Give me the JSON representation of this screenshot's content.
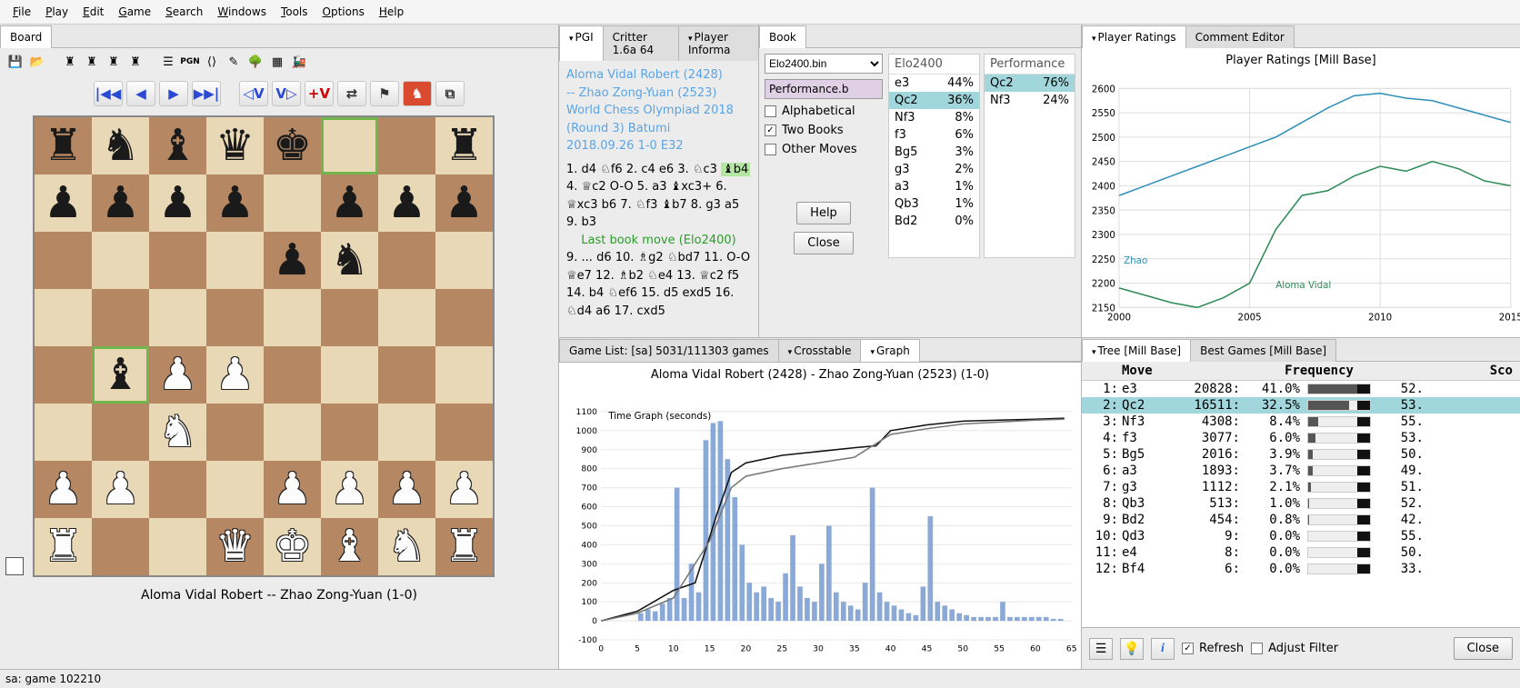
{
  "menu": [
    "File",
    "Play",
    "Edit",
    "Game",
    "Search",
    "Windows",
    "Tools",
    "Options",
    "Help"
  ],
  "board_tab": "Board",
  "board_caption": "Aloma Vidal Robert  --  Zhao Zong-Yuan  (1-0)",
  "status_bar": "sa: game  102210",
  "board": {
    "highlights": [
      "f8",
      "b4"
    ],
    "pieces": {
      "a8": "br",
      "b8": "bn",
      "c8": "bb",
      "d8": "bq",
      "e8": "bk",
      "h8": "br",
      "a7": "bp",
      "b7": "bp",
      "c7": "bp",
      "d7": "bp",
      "f7": "bp",
      "g7": "bp",
      "h7": "bp",
      "e6": "bp",
      "f6": "bn",
      "b4": "bb",
      "c4": "wp",
      "d4": "wp",
      "c3": "wn",
      "a2": "wp",
      "b2": "wp",
      "e2": "wp",
      "f2": "wp",
      "g2": "wp",
      "h2": "wp",
      "a1": "wr",
      "d1": "wq",
      "e1": "wk",
      "f1": "wb",
      "g1": "wn",
      "h1": "wr"
    }
  },
  "pgi": {
    "tabs": [
      "PGI",
      "Critter 1.6a 64",
      "Player Informa"
    ],
    "header": [
      "Aloma Vidal Robert  (2428)",
      "--  Zhao Zong-Yuan  (2523)",
      "World Chess Olympiad 2018 (Round 3)  Batumi",
      "2018.09.26  1-0  E32"
    ],
    "moves_pre": "1. d4 ♘f6 2. c4 e6 3. ♘c3 ",
    "hl_move": "♝b4",
    "moves_post": " 4. ♕c2 O-O 5. a3 ♝xc3+ 6. ♕xc3 b6 7. ♘f3 ♝b7 8. g3 a5 9. b3",
    "book_note": "Last book move (Elo2400)",
    "moves2": "9. ... d6 10. ♗g2 ♘bd7 11. O-O ♕e7 12. ♗b2 ♘e4 13. ♕c2 f5 14. b4 ♘ef6 15. d5 exd5 16. ♘d4 a6 17. cxd5"
  },
  "book": {
    "tab": "Book",
    "file": "Elo2400.bin",
    "perf": "Performance.b",
    "options": {
      "alphabetical": "Alphabetical",
      "two_books": "Two Books",
      "other_moves": "Other Moves"
    },
    "help": "Help",
    "close": "Close",
    "col1": {
      "title": "Elo2400",
      "rows": [
        {
          "m": "e3",
          "p": "44%"
        },
        {
          "m": "Qc2",
          "p": "36%",
          "hl": true
        },
        {
          "m": "Nf3",
          "p": "8%"
        },
        {
          "m": "f3",
          "p": "6%"
        },
        {
          "m": "Bg5",
          "p": "3%"
        },
        {
          "m": "g3",
          "p": "2%"
        },
        {
          "m": "a3",
          "p": "1%"
        },
        {
          "m": "Qb3",
          "p": "1%"
        },
        {
          "m": "Bd2",
          "p": "0%"
        }
      ]
    },
    "col2": {
      "title": "Performance",
      "rows": [
        {
          "m": "Qc2",
          "p": "76%",
          "hl": true
        },
        {
          "m": "Nf3",
          "p": "24%"
        }
      ]
    }
  },
  "player_ratings": {
    "tabs": [
      "Player Ratings",
      "Comment Editor"
    ],
    "title": "Player Ratings [Mill Base]"
  },
  "chart_data": [
    {
      "id": "ratings",
      "type": "line",
      "title": "Player Ratings [Mill Base]",
      "xlabel": "",
      "ylabel": "",
      "xlim": [
        2000,
        2015
      ],
      "ylim": [
        2150,
        2600
      ],
      "xticks": [
        2000,
        2005,
        2010,
        2015
      ],
      "yticks": [
        2150,
        2200,
        2250,
        2300,
        2350,
        2400,
        2450,
        2500,
        2550,
        2600
      ],
      "series": [
        {
          "name": "Zhao",
          "color": "#2f8fb7",
          "values": [
            [
              2000,
              2380
            ],
            [
              2001,
              2400
            ],
            [
              2002,
              2420
            ],
            [
              2003,
              2440
            ],
            [
              2004,
              2460
            ],
            [
              2005,
              2480
            ],
            [
              2006,
              2500
            ],
            [
              2007,
              2530
            ],
            [
              2008,
              2560
            ],
            [
              2009,
              2585
            ],
            [
              2010,
              2590
            ],
            [
              2011,
              2580
            ],
            [
              2012,
              2575
            ],
            [
              2013,
              2560
            ],
            [
              2014,
              2545
            ],
            [
              2015,
              2530
            ]
          ]
        },
        {
          "name": "Aloma Vidal",
          "color": "#2e8b57",
          "values": [
            [
              2000,
              2190
            ],
            [
              2001,
              2175
            ],
            [
              2002,
              2160
            ],
            [
              2003,
              2150
            ],
            [
              2004,
              2170
            ],
            [
              2005,
              2200
            ],
            [
              2006,
              2310
            ],
            [
              2007,
              2380
            ],
            [
              2008,
              2390
            ],
            [
              2009,
              2420
            ],
            [
              2010,
              2440
            ],
            [
              2011,
              2430
            ],
            [
              2012,
              2450
            ],
            [
              2013,
              2435
            ],
            [
              2014,
              2410
            ],
            [
              2015,
              2400
            ]
          ]
        }
      ]
    },
    {
      "id": "time_graph",
      "type": "bar",
      "title": "Aloma Vidal Robert (2428) - Zhao Zong-Yuan (2523) (1-0)",
      "subtitle": "Time Graph (seconds)",
      "xlabel": "",
      "ylabel": "",
      "xlim": [
        0,
        65
      ],
      "ylim": [
        -100,
        1100
      ],
      "yticks": [
        -100,
        0,
        100,
        200,
        300,
        400,
        500,
        600,
        700,
        800,
        900,
        1000,
        1100
      ],
      "xticks": [
        0,
        5,
        10,
        15,
        20,
        25,
        30,
        35,
        40,
        45,
        50,
        55,
        60,
        65
      ],
      "categories_count": 65,
      "bar_color": "#8aa9d6",
      "values": [
        0,
        0,
        0,
        0,
        0,
        40,
        60,
        50,
        90,
        120,
        700,
        120,
        300,
        150,
        950,
        1040,
        1050,
        850,
        650,
        400,
        200,
        150,
        180,
        120,
        100,
        250,
        450,
        180,
        120,
        100,
        300,
        500,
        150,
        100,
        80,
        60,
        200,
        700,
        150,
        100,
        80,
        60,
        40,
        30,
        180,
        550,
        100,
        80,
        60,
        40,
        30,
        20,
        20,
        20,
        20,
        100,
        20,
        20,
        20,
        20,
        20,
        20,
        10,
        10
      ],
      "lines": [
        {
          "name": "white_clock",
          "color": "#111",
          "values": [
            [
              0,
              0
            ],
            [
              5,
              50
            ],
            [
              10,
              160
            ],
            [
              13,
              200
            ],
            [
              16,
              560
            ],
            [
              18,
              780
            ],
            [
              20,
              830
            ],
            [
              25,
              870
            ],
            [
              30,
              890
            ],
            [
              35,
              910
            ],
            [
              38,
              920
            ],
            [
              40,
              1000
            ],
            [
              45,
              1030
            ],
            [
              50,
              1050
            ],
            [
              55,
              1055
            ],
            [
              60,
              1060
            ],
            [
              64,
              1065
            ]
          ]
        },
        {
          "name": "black_clock",
          "color": "#777",
          "values": [
            [
              0,
              0
            ],
            [
              5,
              40
            ],
            [
              10,
              120
            ],
            [
              15,
              420
            ],
            [
              18,
              700
            ],
            [
              20,
              760
            ],
            [
              25,
              800
            ],
            [
              30,
              830
            ],
            [
              35,
              860
            ],
            [
              40,
              980
            ],
            [
              45,
              1010
            ],
            [
              50,
              1035
            ],
            [
              55,
              1045
            ],
            [
              60,
              1055
            ],
            [
              64,
              1060
            ]
          ]
        }
      ]
    }
  ],
  "gamelist": {
    "tabs_left": "Game List: [sa] 5031/111303 games",
    "tabs": [
      "Crosstable",
      "Graph"
    ]
  },
  "tree": {
    "tabs": [
      "Tree [Mill Base]",
      "Best Games [Mill Base]"
    ],
    "head": {
      "move": "Move",
      "freq": "Frequency",
      "sco": "Sco"
    },
    "rows": [
      {
        "i": 1,
        "m": "e3",
        "n": 20828,
        "p": "41.0%",
        "bar": 41,
        "sc": "52."
      },
      {
        "i": 2,
        "m": "Qc2",
        "n": 16511,
        "p": "32.5%",
        "bar": 33,
        "sc": "53.",
        "hl": true
      },
      {
        "i": 3,
        "m": "Nf3",
        "n": 4308,
        "p": "8.4%",
        "bar": 8,
        "sc": "55."
      },
      {
        "i": 4,
        "m": "f3",
        "n": 3077,
        "p": "6.0%",
        "bar": 6,
        "sc": "53."
      },
      {
        "i": 5,
        "m": "Bg5",
        "n": 2016,
        "p": "3.9%",
        "bar": 4,
        "sc": "50."
      },
      {
        "i": 6,
        "m": "a3",
        "n": 1893,
        "p": "3.7%",
        "bar": 4,
        "sc": "49."
      },
      {
        "i": 7,
        "m": "g3",
        "n": 1112,
        "p": "2.1%",
        "bar": 2,
        "sc": "51."
      },
      {
        "i": 8,
        "m": "Qb3",
        "n": 513,
        "p": "1.0%",
        "bar": 1,
        "sc": "52."
      },
      {
        "i": 9,
        "m": "Bd2",
        "n": 454,
        "p": "0.8%",
        "bar": 1,
        "sc": "42."
      },
      {
        "i": 10,
        "m": "Qd3",
        "n": 9,
        "p": "0.0%",
        "bar": 0,
        "sc": "55."
      },
      {
        "i": 11,
        "m": "e4",
        "n": 8,
        "p": "0.0%",
        "bar": 0,
        "sc": "50."
      },
      {
        "i": 12,
        "m": "Bf4",
        "n": 6,
        "p": "0.0%",
        "bar": 0,
        "sc": "33."
      }
    ],
    "footer": {
      "refresh": "Refresh",
      "adjust": "Adjust Filter",
      "close": "Close"
    }
  }
}
